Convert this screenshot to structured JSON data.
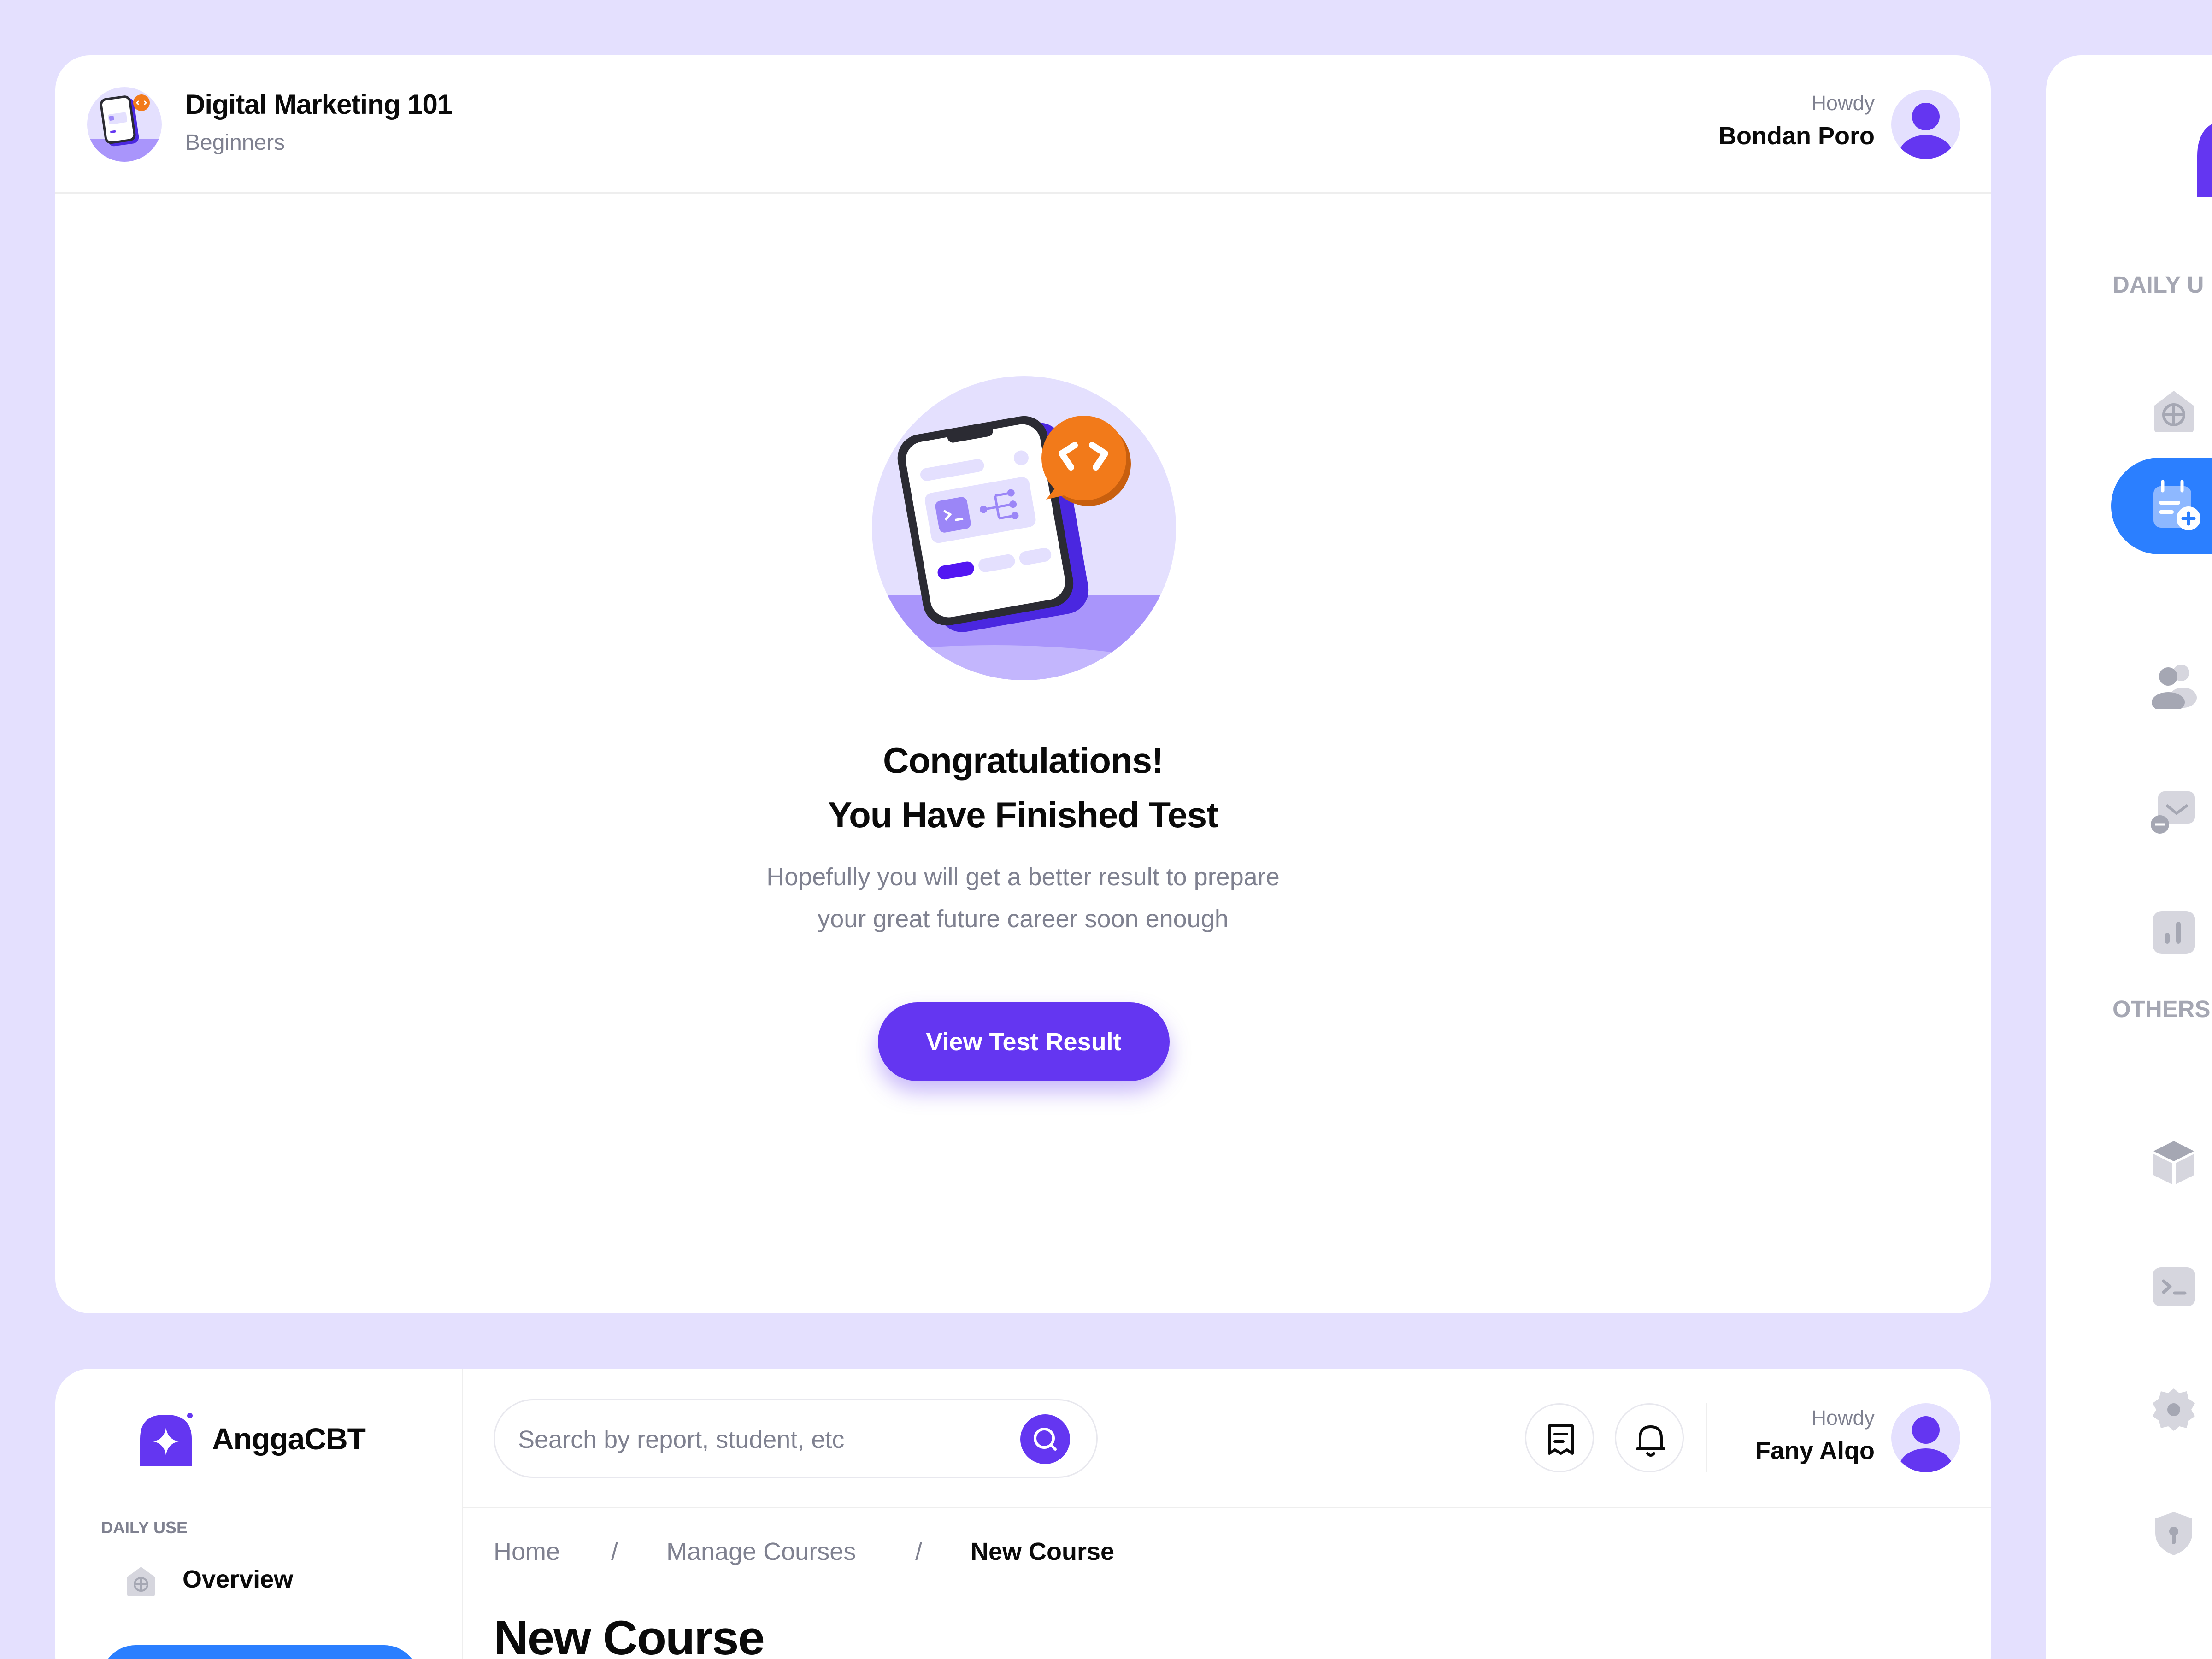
{
  "test_screen": {
    "course": {
      "title": "Digital Marketing 101",
      "level": "Beginners"
    },
    "user": {
      "greeting": "Howdy",
      "name": "Bondan Poro"
    },
    "heading_line1": "Congratulations!",
    "heading_line2": "You Have Finished Test",
    "description_line1": "Hopefully you will get a better result to prepare",
    "description_line2": "your great future career soon enough",
    "button_label": "View Test Result"
  },
  "side_nav": {
    "sections": [
      "DAILY U",
      "OTHERS"
    ],
    "icons": [
      "overview-icon",
      "calendar-add-icon",
      "users-icon",
      "students-icon",
      "chart-icon",
      "box-icon",
      "terminal-icon",
      "settings-icon",
      "shield-icon"
    ],
    "active_index": 1
  },
  "admin": {
    "brand": "AnggaCBT",
    "section_label": "DAILY USE",
    "nav_overview": "Overview",
    "search_placeholder": "Search by report, student, etc",
    "user": {
      "greeting": "Howdy",
      "name": "Fany Alqo"
    },
    "breadcrumb": [
      "Home",
      "Manage Courses",
      "New Course"
    ],
    "breadcrumb_separator": "/",
    "page_title": "New Course"
  },
  "colors": {
    "background": "#E4E0FE",
    "primary": "#6436F1",
    "active_nav": "#2B7FFF",
    "accent_orange": "#F27A1A",
    "muted_text": "#7F8190"
  }
}
